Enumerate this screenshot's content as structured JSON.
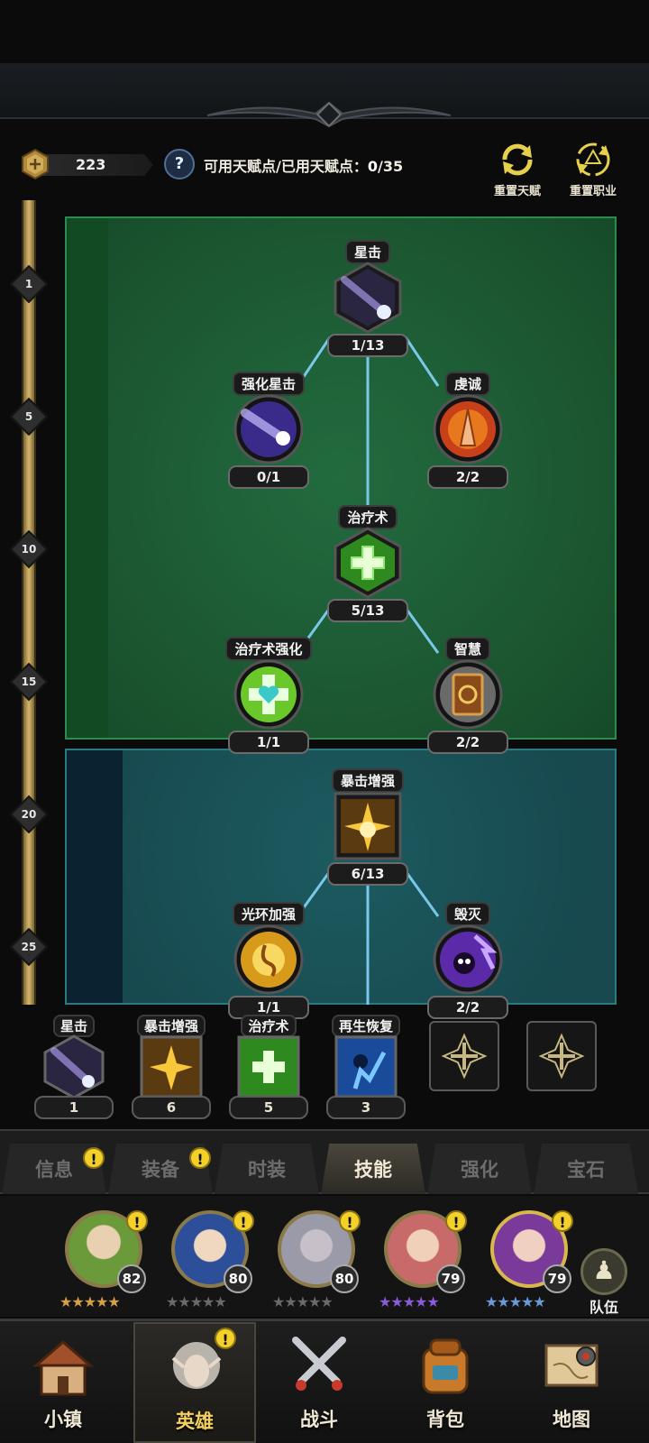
{
  "header": {
    "points_value": "223",
    "help_glyph": "?",
    "talent_label": "可用天赋点/已用天赋点：",
    "talent_available": "0",
    "talent_used": "/35",
    "reset_talent": "重置天赋",
    "reset_class": "重置职业"
  },
  "level_markers": [
    "1",
    "5",
    "10",
    "15",
    "20",
    "25"
  ],
  "talent_tree": {
    "nodes": [
      {
        "id": "star-strike",
        "label": "星击",
        "count": "1/13",
        "icon": "shooting-star-icon",
        "shape": "hex"
      },
      {
        "id": "enhanced-star-strike",
        "label": "强化星击",
        "count": "0/1",
        "icon": "meteor-icon",
        "shape": "circle"
      },
      {
        "id": "devotion",
        "label": "虔诚",
        "count": "2/2",
        "icon": "praying-hands-icon",
        "shape": "circle"
      },
      {
        "id": "heal",
        "label": "治疗术",
        "count": "5/13",
        "icon": "green-cross-icon",
        "shape": "hex"
      },
      {
        "id": "heal-enhance",
        "label": "治疗术强化",
        "count": "1/1",
        "icon": "heart-cross-icon",
        "shape": "circle"
      },
      {
        "id": "wisdom",
        "label": "智慧",
        "count": "2/2",
        "icon": "book-icon",
        "shape": "circle"
      },
      {
        "id": "crit-boost",
        "label": "暴击增强",
        "count": "6/13",
        "icon": "burst-icon",
        "shape": "hex"
      },
      {
        "id": "aura-boost",
        "label": "光环加强",
        "count": "1/1",
        "icon": "aura-icon",
        "shape": "circle"
      },
      {
        "id": "destruction",
        "label": "毁灭",
        "count": "2/2",
        "icon": "skull-icon",
        "shape": "circle"
      }
    ]
  },
  "equipped_skills": [
    {
      "label": "星击",
      "count": "1",
      "icon": "shooting-star-icon"
    },
    {
      "label": "暴击增强",
      "count": "6",
      "icon": "burst-icon"
    },
    {
      "label": "治疗术",
      "count": "5",
      "icon": "green-cross-icon"
    },
    {
      "label": "再生恢复",
      "count": "3",
      "icon": "regen-icon"
    }
  ],
  "empty_slots": 2,
  "tabs": [
    {
      "label": "信息",
      "alert": true
    },
    {
      "label": "装备",
      "alert": true
    },
    {
      "label": "时装",
      "alert": false
    },
    {
      "label": "技能",
      "alert": false,
      "active": true
    },
    {
      "label": "强化",
      "alert": false
    },
    {
      "label": "宝石",
      "alert": false
    }
  ],
  "alert_glyph": "!",
  "heroes": [
    {
      "level": "82",
      "stars": "★★★★★",
      "star_color": "#d8a046",
      "hair": "#6a9a3a"
    },
    {
      "level": "80",
      "stars": "★★★★★",
      "star_color": "#6a6a6a",
      "hair": "#2d4f9a"
    },
    {
      "level": "80",
      "stars": "★★★★★",
      "star_color": "#6a6a6a",
      "hair": "#9a9aa8"
    },
    {
      "level": "79",
      "stars": "★★★★★",
      "star_color": "#8a5ad8",
      "hair": "#c86a6a"
    },
    {
      "level": "79",
      "stars": "★★★★★",
      "star_color": "#6a9ad8",
      "hair": "#7a3a9a"
    }
  ],
  "team_label": "队伍",
  "bottom_nav": [
    {
      "label": "小镇",
      "icon": "town-icon"
    },
    {
      "label": "英雄",
      "icon": "hero-portrait-icon",
      "active": true
    },
    {
      "label": "战斗",
      "icon": "crossed-swords-icon"
    },
    {
      "label": "背包",
      "icon": "backpack-icon"
    },
    {
      "label": "地图",
      "icon": "map-scroll-icon"
    }
  ]
}
